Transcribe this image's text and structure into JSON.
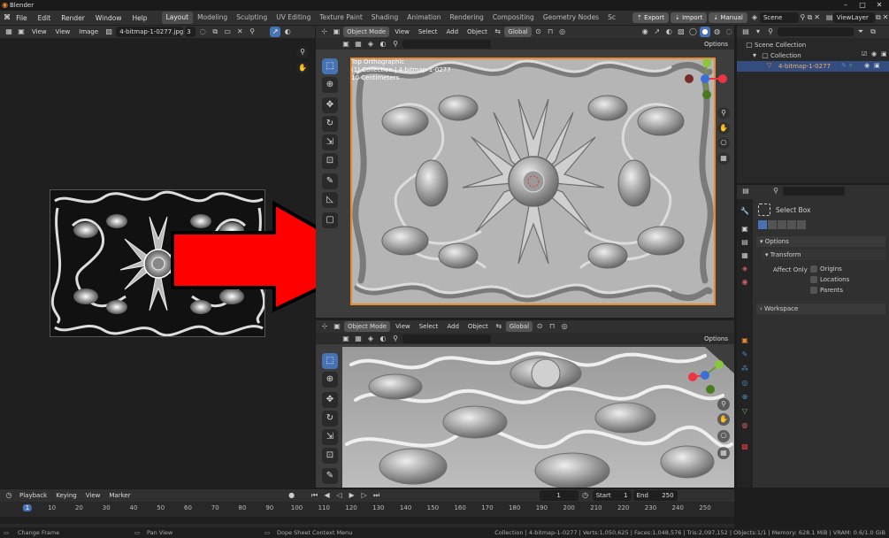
{
  "window": {
    "title": "Blender",
    "minimize": "–",
    "maximize": "□",
    "close": "✕"
  },
  "menu": [
    "File",
    "Edit",
    "Render",
    "Window",
    "Help"
  ],
  "workspaces": [
    "Layout",
    "Modeling",
    "Sculpting",
    "UV Editing",
    "Texture Paint",
    "Shading",
    "Animation",
    "Rendering",
    "Compositing",
    "Geometry Nodes",
    "Sc"
  ],
  "active_workspace": "Layout",
  "topbar": {
    "export": "Export",
    "import": "Import",
    "manual": "Manual",
    "scene": "Scene",
    "view_layer": "ViewLayer"
  },
  "image_editor": {
    "view": "View",
    "view2": "View",
    "image": "Image",
    "filename": "4-bitmap-1-0277.jpg",
    "users": "3"
  },
  "viewport": {
    "mode": "Object Mode",
    "view": "View",
    "select": "Select",
    "add": "Add",
    "object": "Object",
    "transform": "Global",
    "options": "Options",
    "overlay_line1": "Top Orthographic",
    "overlay_line2": "(1) Collection | 4-bitmap-1-0277",
    "overlay_line3": "10 Centimeters"
  },
  "outliner": {
    "scene_collection": "Scene Collection",
    "collection": "Collection",
    "object": "4-bitmap-1-0277"
  },
  "properties": {
    "tool_name": "Select Box",
    "options": "Options",
    "transform": "Transform",
    "affect_only": "Affect Only",
    "origins": "Origins",
    "locations": "Locations",
    "parents": "Parents",
    "workspace": "Workspace"
  },
  "timeline": {
    "playback": "Playback",
    "keying": "Keying",
    "view": "View",
    "marker": "Marker",
    "current_frame": "1",
    "start_label": "Start",
    "start": "1",
    "end_label": "End",
    "end": "250",
    "ticks": [
      "10",
      "20",
      "30",
      "40",
      "50",
      "60",
      "70",
      "80",
      "90",
      "100",
      "110",
      "120",
      "130",
      "140",
      "150",
      "160",
      "170",
      "180",
      "190",
      "200",
      "210",
      "220",
      "230",
      "240",
      "250"
    ],
    "current_tick": "1"
  },
  "statusbar": {
    "left1": "Change Frame",
    "left2": "Pan View",
    "left3": "Dope Sheet Context Menu",
    "right": "Collection | 4-bitmap-1-0277 | Verts:1,050,625 | Faces:1,048,576 | Tris:2,097,152 | Objects:1/1 | Memory: 628.1 MiB | VRAM: 0.6/1.0 GiB"
  },
  "colors": {
    "accent": "#4772b3",
    "active_orange": "#e88a2d",
    "arrow_red": "#ff0000"
  }
}
